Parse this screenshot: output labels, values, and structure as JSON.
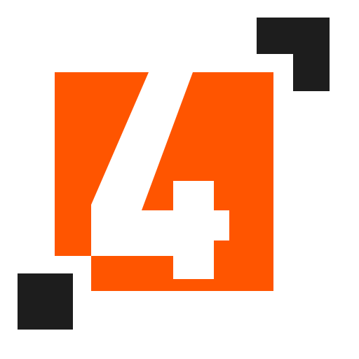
{
  "logo": {
    "digit": "4",
    "colors": {
      "primary": "#ff5500",
      "dark": "#1d1d1d",
      "background": "#ffffff",
      "glyph": "#ffffff"
    }
  }
}
